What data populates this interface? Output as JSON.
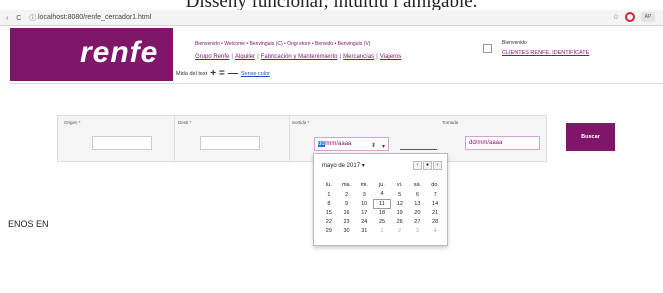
{
  "caption": "Disseny funcional; intuitiu i amigable.",
  "browser": {
    "back_icon": "‹",
    "reload_icon": "C",
    "info_icon": "ⓘ",
    "url": "localhost:8080/renfe_cercador1.html",
    "star_icon": "☆",
    "ext_label": "AP"
  },
  "header": {
    "logo": "renfe",
    "top_links": "Bienvenido • Welcome • Benvinguts (C) • Ongi etorri • Benvido • Benvinguts (V)",
    "main_menu": [
      "Grupo Renfe",
      "Alquiler",
      "Fabricación y Mantenimiento",
      "Mercancías",
      "Viajeros"
    ],
    "font_size_label": "Mida del text",
    "plus_icon": "+",
    "equal_icon": "=",
    "minus_icon": "—",
    "no_color_label": "Sense color",
    "welcome_label": "Bienvenido",
    "clientes_link": "CLIENTES RENFE. IDENTIFÍCATE"
  },
  "search": {
    "origen_label": "Origen *",
    "desti_label": "Desti *",
    "sortida_label": "Sortida *",
    "tornada_label": "Tornada",
    "sortida_sel": "dd",
    "sortida_rest": "/mm/aaaa",
    "spin_icon": "⬍",
    "drop_icon": "▾",
    "tornada_placeholder": "dd/mm/aaaa",
    "buscar_label": "Buscar"
  },
  "calendar": {
    "month_label": "mayo de 2017",
    "month_drop": "▾",
    "prev": "‹",
    "today": "●",
    "next": "›",
    "weekdays": [
      "lu.",
      "ma.",
      "mi.",
      "ju.",
      "vi.",
      "sá.",
      "do."
    ],
    "weeks": [
      [
        "1",
        "2",
        "3",
        "4",
        "5",
        "6",
        "7"
      ],
      [
        "8",
        "9",
        "10",
        "11",
        "12",
        "13",
        "14"
      ],
      [
        "15",
        "16",
        "17",
        "18",
        "19",
        "20",
        "21"
      ],
      [
        "22",
        "23",
        "24",
        "25",
        "26",
        "27",
        "28"
      ],
      [
        "29",
        "30",
        "31",
        "1",
        "2",
        "3",
        "4"
      ]
    ],
    "dim_from_week": 4,
    "dim_from_col": 3,
    "today_week": 1,
    "today_col": 3
  },
  "body_text": "ENOS EN"
}
